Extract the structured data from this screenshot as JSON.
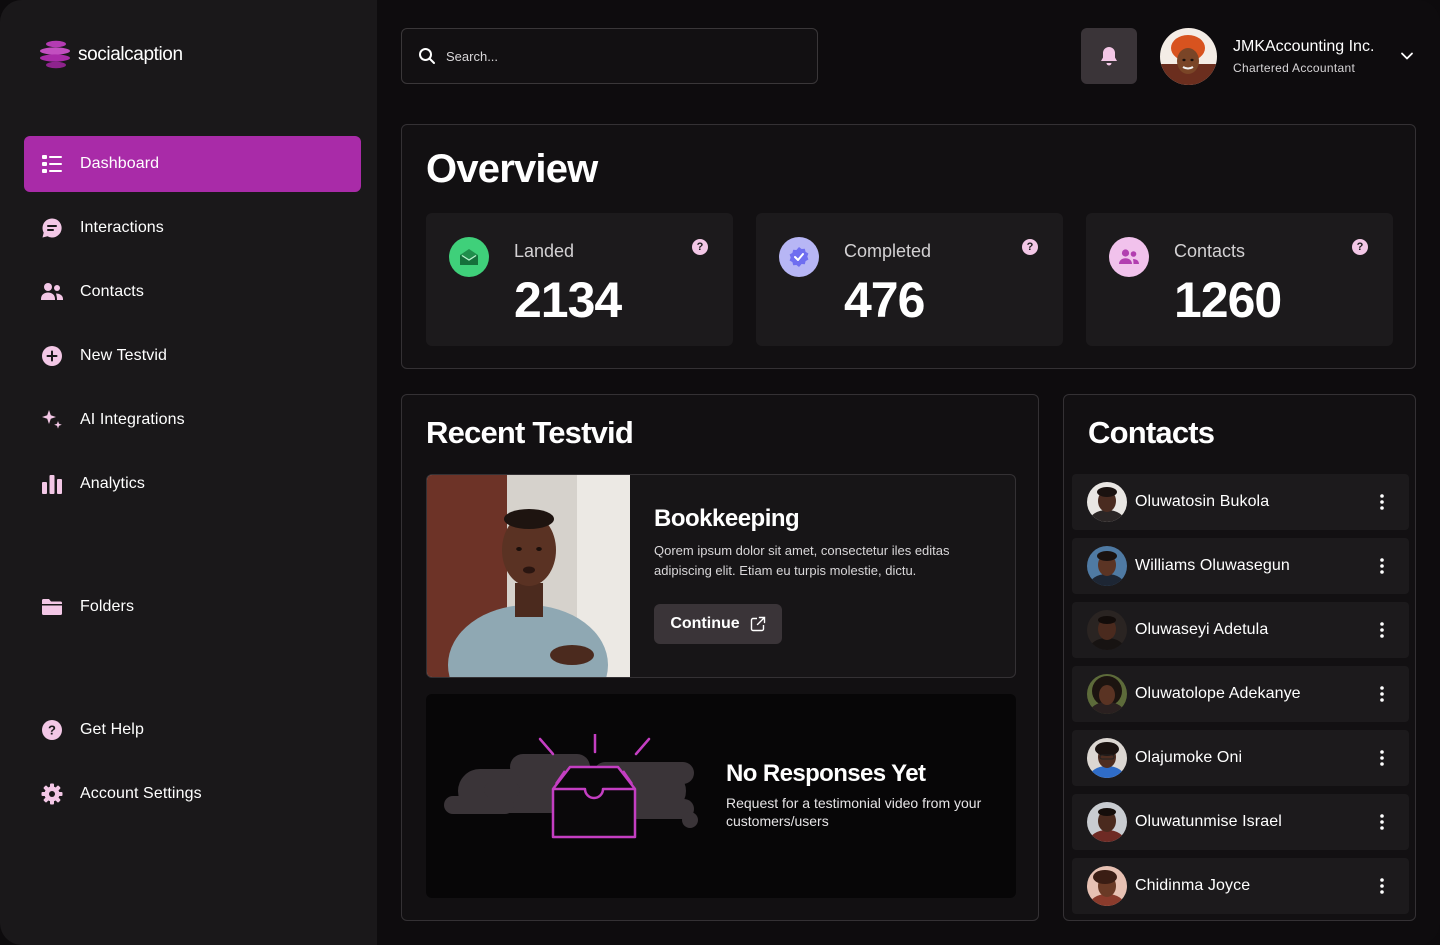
{
  "brand": {
    "name": "socialcaption",
    "accent": "#a92ba8"
  },
  "sidebar": {
    "items": [
      {
        "label": "Dashboard",
        "icon": "list-icon",
        "active": true
      },
      {
        "label": "Interactions",
        "icon": "chat-bubble-icon"
      },
      {
        "label": "Contacts",
        "icon": "users-icon"
      },
      {
        "label": "New Testvid",
        "icon": "plus-circle-icon"
      },
      {
        "label": "AI Integrations",
        "icon": "sparkle-icon"
      },
      {
        "label": "Analytics",
        "icon": "bar-chart-icon"
      },
      {
        "label": "Folders",
        "icon": "folder-icon"
      },
      {
        "label": "Get Help",
        "icon": "question-circle-icon"
      },
      {
        "label": "Account Settings",
        "icon": "gear-icon"
      }
    ]
  },
  "header": {
    "search_placeholder": "Search...",
    "user": {
      "name": "JMKAccounting Inc.",
      "role": "Chartered Accountant"
    }
  },
  "overview": {
    "title": "Overview",
    "stats": [
      {
        "label": "Landed",
        "value": "2134",
        "icon": "envelope-open-icon",
        "color": "#3fd07a"
      },
      {
        "label": "Completed",
        "value": "476",
        "icon": "verified-badge-icon",
        "color": "#6f6ef0"
      },
      {
        "label": "Contacts",
        "value": "1260",
        "icon": "users-icon",
        "color": "#e8a6e0"
      }
    ]
  },
  "recent": {
    "title": "Recent Testvid",
    "video": {
      "title": "Bookkeeping",
      "description": "Qorem ipsum dolor sit amet, consectetur iles editas adipiscing elit. Etiam eu turpis molestie, dictu.",
      "button": "Continue"
    },
    "empty": {
      "title": "No Responses Yet",
      "description": "Request for a testimonial video from your customers/users"
    }
  },
  "contacts": {
    "title": "Contacts",
    "items": [
      {
        "name": "Oluwatosin Bukola"
      },
      {
        "name": "Williams Oluwasegun"
      },
      {
        "name": "Oluwaseyi Adetula"
      },
      {
        "name": "Oluwatolope Adekanye"
      },
      {
        "name": "Olajumoke Oni"
      },
      {
        "name": "Oluwatunmise Israel"
      },
      {
        "name": "Chidinma Joyce"
      }
    ]
  }
}
